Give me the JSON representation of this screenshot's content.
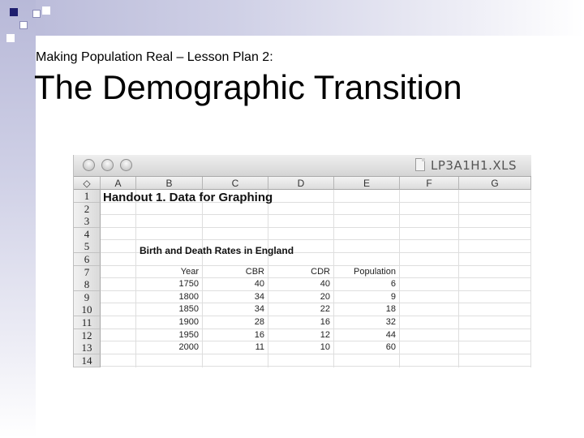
{
  "slide": {
    "subtitle": "Making Population Real – Lesson Plan 2:",
    "title": "The Demographic Transition"
  },
  "window": {
    "filename": "LP3A1H1.XLS",
    "icons": [
      "close-button",
      "minimize-button",
      "zoom-button",
      "document-icon"
    ]
  },
  "spreadsheet": {
    "select_all": "◇",
    "columns": [
      "A",
      "B",
      "C",
      "D",
      "E",
      "F",
      "G"
    ],
    "rows": [
      "1",
      "2",
      "3",
      "4",
      "5",
      "6",
      "7",
      "8",
      "9",
      "10",
      "11",
      "12",
      "13",
      "14"
    ],
    "handout_title": "Handout 1. Data for Graphing",
    "table_title": "Birth and Death Rates in England",
    "headers": [
      "Year",
      "CBR",
      "CDR",
      "Population"
    ],
    "data": [
      [
        "1750",
        "40",
        "40",
        "6"
      ],
      [
        "1800",
        "34",
        "20",
        "9"
      ],
      [
        "1850",
        "34",
        "22",
        "18"
      ],
      [
        "1900",
        "28",
        "16",
        "32"
      ],
      [
        "1950",
        "16",
        "12",
        "44"
      ],
      [
        "2000",
        "11",
        "10",
        "60"
      ]
    ]
  }
}
